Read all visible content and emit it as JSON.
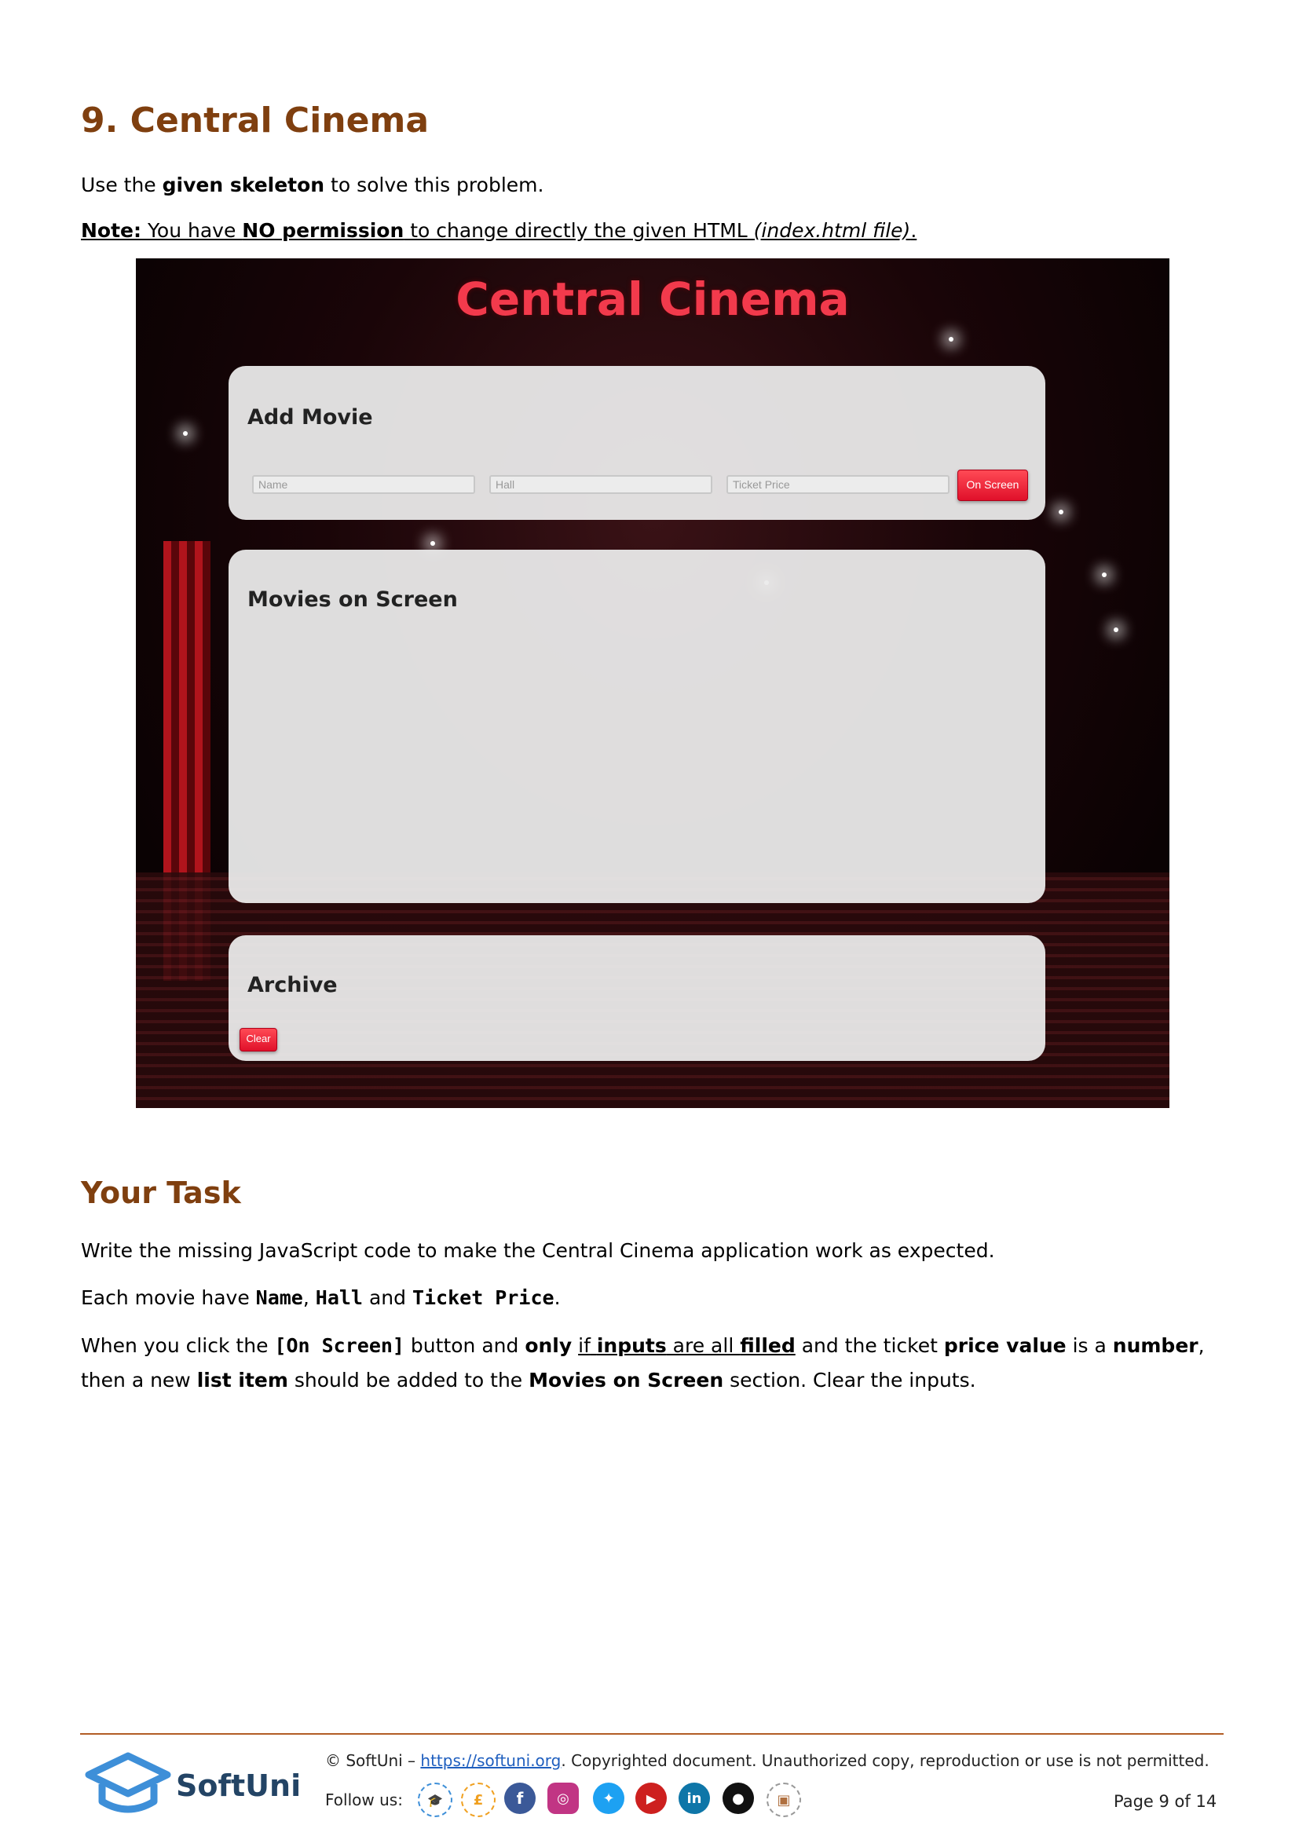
{
  "heading": "9. Central Cinema",
  "intro": {
    "p1_a": "Use the ",
    "p1_b": "given skeleton",
    "p1_c": " to solve this problem.",
    "note_label": "Note:",
    "note_a": " You have ",
    "note_b": "NO permission",
    "note_c": " to change directly the given HTML ",
    "note_d": "(index.html file)",
    "note_e": "."
  },
  "screenshot": {
    "app_title": "Central Cinema",
    "add_movie": {
      "heading": "Add Movie",
      "name_placeholder": "Name",
      "hall_placeholder": "Hall",
      "price_placeholder": "Ticket Price",
      "button": "On Screen"
    },
    "movies_on_screen": {
      "heading": "Movies on Screen"
    },
    "archive": {
      "heading": "Archive",
      "button": "Clear"
    }
  },
  "task": {
    "heading": "Your Task",
    "p1": "Write the missing JavaScript code to make the Central Cinema application work as expected.",
    "p2_a": "Each movie have ",
    "p2_name": "Name",
    "p2_sep": ", ",
    "p2_hall": "Hall",
    "p2_and": " and ",
    "p2_price": "Ticket Price",
    "p2_end": ".",
    "p3_a": "When you click the ",
    "p3_btn": "[On Screen]",
    "p3_b": " button and ",
    "p3_only": "only",
    "p3_space": " ",
    "p3_if": "if",
    "p3_inputs": "inputs",
    "p3_are_all": " are all ",
    "p3_filled": "filled",
    "p3_c": " and the ticket ",
    "p3_price_value": "price value",
    "p3_d": " is a ",
    "p3_number": "number",
    "p3_e": ",",
    "p4_a": "then a new ",
    "p4_list_item": "list item",
    "p4_b": " should be added to the ",
    "p4_section": "Movies on Screen",
    "p4_c": " section. Clear the inputs."
  },
  "footer": {
    "copyright_a": "© SoftUni – ",
    "link": "https://softuni.org",
    "copyright_b": ". Copyrighted document. Unauthorized copy, reproduction or use is not permitted.",
    "follow": "Follow us:",
    "logo_text": "SoftUni",
    "page": "Page 9 of 14",
    "colors": {
      "accent": "#7f3f0f",
      "rule": "#b25d25",
      "link": "#1f5fbf"
    }
  }
}
